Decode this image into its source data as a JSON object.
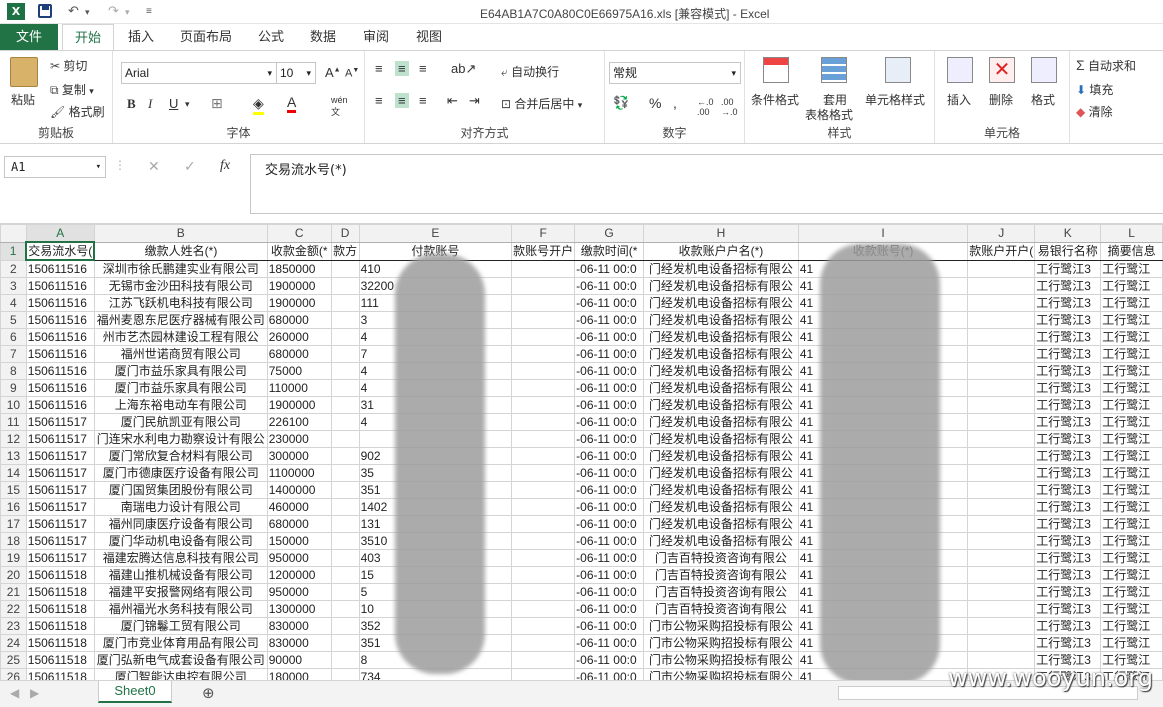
{
  "window": {
    "title": "E64AB1A7C0A80C0E66975A16.xls  [兼容模式] - Excel"
  },
  "tabs": {
    "file": "文件",
    "home": "开始",
    "insert": "插入",
    "layout": "页面布局",
    "formulas": "公式",
    "data": "数据",
    "review": "审阅",
    "view": "视图"
  },
  "clipboard": {
    "paste": "粘贴",
    "cut": "剪切",
    "copy": "复制",
    "painter": "格式刷",
    "label": "剪贴板"
  },
  "font": {
    "name": "Arial",
    "size": "10",
    "label": "字体"
  },
  "align": {
    "wrap": "自动换行",
    "merge": "合并后居中",
    "label": "对齐方式"
  },
  "number": {
    "format": "常规",
    "label": "数字"
  },
  "styles": {
    "cond": "条件格式",
    "table1": "套用",
    "table2": "表格格式",
    "cell": "单元格样式",
    "label": "样式"
  },
  "cells": {
    "insert": "插入",
    "delete": "删除",
    "format": "格式",
    "label": "单元格"
  },
  "editing": {
    "autosum": "自动求和",
    "fill": "填充",
    "clear": "清除"
  },
  "formula": {
    "namebox": "A1",
    "fx": "fx",
    "content": "交易流水号(*)"
  },
  "columns": [
    "A",
    "B",
    "C",
    "D",
    "E",
    "F",
    "G",
    "H",
    "I",
    "J",
    "K",
    "L"
  ],
  "header": [
    "交易流水号(",
    "缴款人姓名(*)",
    "收款金额(*",
    "款方",
    "付款账号",
    "款账号开户",
    "缴款时间(*",
    "收款账户户名(*)",
    "收款账号(*)",
    "款账户开户(",
    "易银行名称",
    "摘要信息"
  ],
  "rows": [
    [
      "2",
      "150611516",
      "深圳市徐氏鹏建实业有限公司",
      "1850000",
      "",
      "410",
      "",
      "-06-11 00:0",
      "门经发机电设备招标有限公",
      "41",
      "",
      "工行鹭江3",
      "工行鹭江"
    ],
    [
      "3",
      "150611516",
      "无锡市金沙田科技有限公司",
      "1900000",
      "",
      "32200",
      "",
      "-06-11 00:0",
      "门经发机电设备招标有限公",
      "41",
      "",
      "工行鹭江3",
      "工行鹭江"
    ],
    [
      "4",
      "150611516",
      "江苏飞跃机电科技有限公司",
      "1900000",
      "",
      "111",
      "",
      "-06-11 00:0",
      "门经发机电设备招标有限公",
      "41",
      "",
      "工行鹭江3",
      "工行鹭江"
    ],
    [
      "5",
      "150611516",
      "福州麦恩东尼医疗器械有限公司",
      "680000",
      "",
      "3",
      "",
      "-06-11 00:0",
      "门经发机电设备招标有限公",
      "41",
      "",
      "工行鹭江3",
      "工行鹭江"
    ],
    [
      "6",
      "150611516",
      "州市艺杰园林建设工程有限公",
      "260000",
      "",
      "4",
      "",
      "-06-11 00:0",
      "门经发机电设备招标有限公",
      "41",
      "",
      "工行鹭江3",
      "工行鹭江"
    ],
    [
      "7",
      "150611516",
      "福州世诺商贸有限公司",
      "680000",
      "",
      "7",
      "",
      "-06-11 00:0",
      "门经发机电设备招标有限公",
      "41",
      "",
      "工行鹭江3",
      "工行鹭江"
    ],
    [
      "8",
      "150611516",
      "厦门市益乐家具有限公司",
      "75000",
      "",
      "4",
      "",
      "-06-11 00:0",
      "门经发机电设备招标有限公",
      "41",
      "",
      "工行鹭江3",
      "工行鹭江"
    ],
    [
      "9",
      "150611516",
      "厦门市益乐家具有限公司",
      "110000",
      "",
      "4",
      "",
      "-06-11 00:0",
      "门经发机电设备招标有限公",
      "41",
      "",
      "工行鹭江3",
      "工行鹭江"
    ],
    [
      "10",
      "150611516",
      "上海东裕电动车有限公司",
      "1900000",
      "",
      "31",
      "",
      "-06-11 00:0",
      "门经发机电设备招标有限公",
      "41",
      "",
      "工行鹭江3",
      "工行鹭江"
    ],
    [
      "11",
      "150611517",
      "厦门民航凯亚有限公司",
      "226100",
      "",
      "4",
      "",
      "-06-11 00:0",
      "门经发机电设备招标有限公",
      "41",
      "",
      "工行鹭江3",
      "工行鹭江"
    ],
    [
      "12",
      "150611517",
      "门连宋水利电力勘察设计有限公",
      "230000",
      "",
      "",
      "",
      "-06-11 00:0",
      "门经发机电设备招标有限公",
      "41",
      "",
      "工行鹭江3",
      "工行鹭江"
    ],
    [
      "13",
      "150611517",
      "厦门常欣复合材料有限公司",
      "300000",
      "",
      "902",
      "",
      "-06-11 00:0",
      "门经发机电设备招标有限公",
      "41",
      "",
      "工行鹭江3",
      "工行鹭江"
    ],
    [
      "14",
      "150611517",
      "厦门市德康医疗设备有限公司",
      "1100000",
      "",
      "35",
      "",
      "-06-11 00:0",
      "门经发机电设备招标有限公",
      "41",
      "",
      "工行鹭江3",
      "工行鹭江"
    ],
    [
      "15",
      "150611517",
      "厦门国贸集团股份有限公司",
      "1400000",
      "",
      "351",
      "",
      "-06-11 00:0",
      "门经发机电设备招标有限公",
      "41",
      "",
      "工行鹭江3",
      "工行鹭江"
    ],
    [
      "16",
      "150611517",
      "南瑞电力设计有限公司",
      "460000",
      "",
      "1402",
      "",
      "-06-11 00:0",
      "门经发机电设备招标有限公",
      "41",
      "",
      "工行鹭江3",
      "工行鹭江"
    ],
    [
      "17",
      "150611517",
      "福州同康医疗设备有限公司",
      "680000",
      "",
      "131",
      "",
      "-06-11 00:0",
      "门经发机电设备招标有限公",
      "41",
      "",
      "工行鹭江3",
      "工行鹭江"
    ],
    [
      "18",
      "150611517",
      "厦门华动机电设备有限公司",
      "150000",
      "",
      "3510",
      "",
      "-06-11 00:0",
      "门经发机电设备招标有限公",
      "41",
      "",
      "工行鹭江3",
      "工行鹭江"
    ],
    [
      "19",
      "150611517",
      "福建宏腾达信息科技有限公司",
      "950000",
      "",
      "403",
      "",
      "-06-11 00:0",
      "门吉百特投资咨询有限公",
      "41",
      "",
      "工行鹭江3",
      "工行鹭江"
    ],
    [
      "20",
      "150611518",
      "福建山推机械设备有限公司",
      "1200000",
      "",
      "15",
      "",
      "-06-11 00:0",
      "门吉百特投资咨询有限公",
      "41",
      "",
      "工行鹭江3",
      "工行鹭江"
    ],
    [
      "21",
      "150611518",
      "福建平安报警网络有限公司",
      "950000",
      "",
      "5",
      "",
      "-06-11 00:0",
      "门吉百特投资咨询有限公",
      "41",
      "",
      "工行鹭江3",
      "工行鹭江"
    ],
    [
      "22",
      "150611518",
      "福州福光水务科技有限公司",
      "1300000",
      "",
      "10",
      "",
      "-06-11 00:0",
      "门吉百特投资咨询有限公",
      "41",
      "",
      "工行鹭江3",
      "工行鹭江"
    ],
    [
      "23",
      "150611518",
      "厦门锦鬈工贸有限公司",
      "830000",
      "",
      "352",
      "",
      "-06-11 00:0",
      "门市公物采购招投标有限公",
      "41",
      "",
      "工行鹭江3",
      "工行鹭江"
    ],
    [
      "24",
      "150611518",
      "厦门市竞业体育用品有限公司",
      "830000",
      "",
      "351",
      "",
      "-06-11 00:0",
      "门市公物采购招投标有限公",
      "41",
      "",
      "工行鹭江3",
      "工行鹭江"
    ],
    [
      "25",
      "150611518",
      "厦门弘新电气成套设备有限公司",
      "90000",
      "",
      "8",
      "",
      "-06-11 00:0",
      "门市公物采购招投标有限公",
      "41",
      "",
      "工行鹭江3",
      "工行鹭江"
    ],
    [
      "26",
      "150611518",
      "厦门智能达电控有限公司",
      "180000",
      "",
      "734",
      "",
      "-06-11 00:0",
      "门市公物采购招投标有限公",
      "41",
      "",
      "工行鹭江3",
      "工行鹭江"
    ]
  ],
  "sheet": {
    "tab": "Sheet0"
  },
  "watermark": "www.wooyun.org"
}
